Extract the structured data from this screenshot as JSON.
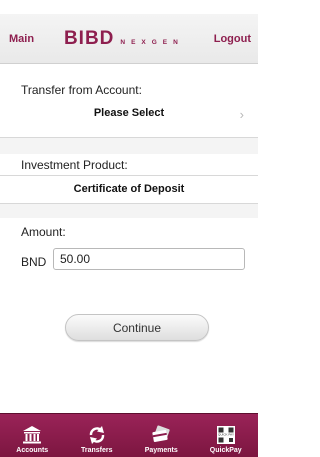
{
  "header": {
    "main_label": "Main",
    "logo_text": "BIBD",
    "logo_subtext": "NEXGEN",
    "logout_label": "Logout"
  },
  "transfer_from": {
    "label": "Transfer from Account:",
    "value": "Please Select"
  },
  "investment": {
    "label": "Investment Product:",
    "value": "Certificate of Deposit"
  },
  "amount": {
    "label": "Amount:",
    "currency": "BND",
    "value": "50.00"
  },
  "continue_label": "Continue",
  "tabs": [
    {
      "label": "Accounts",
      "icon": "bank-icon"
    },
    {
      "label": "Transfers",
      "icon": "transfer-arrows-icon"
    },
    {
      "label": "Payments",
      "icon": "payment-cards-icon"
    },
    {
      "label": "QuickPay",
      "icon": "qr-code-icon"
    }
  ],
  "quickpay_icon_text": "QUICK PAY",
  "colors": {
    "brand": "#8e1f4f",
    "tabbar": "#8a1c4c"
  }
}
